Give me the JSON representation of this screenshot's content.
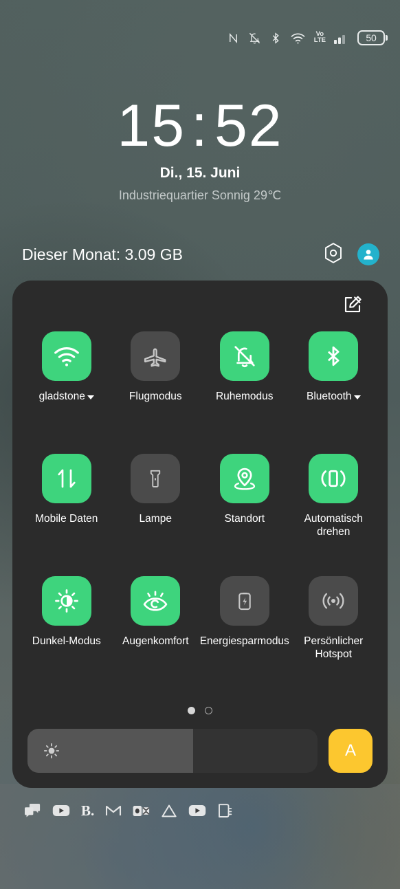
{
  "statusbar": {
    "icons": [
      {
        "name": "nfc-icon",
        "label": "N"
      },
      {
        "name": "notifications-muted-icon",
        "label": "bell-off"
      },
      {
        "name": "bluetooth-icon",
        "label": "bluetooth"
      },
      {
        "name": "wifi-icon",
        "label": "wifi"
      },
      {
        "name": "volte-icon",
        "label": "VoLTE"
      },
      {
        "name": "cellular-signal-icon",
        "label": "signal"
      }
    ],
    "volte_top": "Vo",
    "volte_bottom": "LTE",
    "battery_level": "50"
  },
  "lockscreen": {
    "time_hours": "15",
    "time_colon": ":",
    "time_minutes": "52",
    "date": "Di., 15. Juni",
    "weather": "Industriequartier Sonnig 29℃"
  },
  "data_row": {
    "usage": "Dieser Monat: 3.09 GB",
    "settings_icon": "hexagon-settings-icon",
    "avatar_icon": "user-avatar-icon"
  },
  "panel": {
    "edit_icon": "edit-pencil-icon",
    "tiles": [
      {
        "label": "gladstone",
        "icon": "wifi-icon",
        "state": "on",
        "caret": true
      },
      {
        "label": "Flugmodus",
        "icon": "airplane-icon",
        "state": "off",
        "caret": false
      },
      {
        "label": "Ruhemodus",
        "icon": "bell-off-icon",
        "state": "on",
        "caret": false
      },
      {
        "label": "Bluetooth",
        "icon": "bluetooth-icon",
        "state": "on",
        "caret": true
      },
      {
        "label": "Mobile Daten",
        "icon": "data-transfer-icon",
        "state": "on",
        "caret": false
      },
      {
        "label": "Lampe",
        "icon": "flashlight-icon",
        "state": "off",
        "caret": false
      },
      {
        "label": "Standort",
        "icon": "location-pin-icon",
        "state": "on",
        "caret": false
      },
      {
        "label": "Automatisch drehen",
        "icon": "auto-rotate-icon",
        "state": "on",
        "caret": false
      },
      {
        "label": "Dunkel-Modus",
        "icon": "dark-mode-icon",
        "state": "on",
        "caret": false
      },
      {
        "label": "Augenkomfort",
        "icon": "eye-comfort-icon",
        "state": "on",
        "caret": false
      },
      {
        "label": "Energiesparmodus",
        "icon": "battery-saver-icon",
        "state": "off",
        "caret": false
      },
      {
        "label": "Persönlicher Hotspot",
        "icon": "hotspot-icon",
        "state": "off",
        "caret": false
      }
    ],
    "pager": {
      "pages": 2,
      "current": 1
    },
    "brightness": {
      "icon": "brightness-sun-icon",
      "fill_percent": 57,
      "auto_label": "A"
    }
  },
  "app_strip": [
    {
      "name": "messages-icon",
      "label": "messages"
    },
    {
      "name": "youtube-icon",
      "label": "youtube"
    },
    {
      "name": "b-app-icon",
      "label": "B."
    },
    {
      "name": "gmail-icon",
      "label": "gmail"
    },
    {
      "name": "outlook-icon",
      "label": "outlook"
    },
    {
      "name": "drive-icon",
      "label": "drive"
    },
    {
      "name": "youtube-music-icon",
      "label": "youtube"
    },
    {
      "name": "notes-icon",
      "label": "notes"
    }
  ],
  "colors": {
    "tile_on": "#3ed47d",
    "tile_off": "#4b4b4b",
    "panel_bg": "#2b2b2b",
    "auto_brightness": "#fcc72f",
    "avatar": "#23b2cc"
  }
}
